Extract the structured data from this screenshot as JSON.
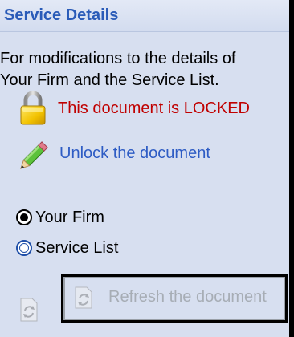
{
  "header": {
    "title": "Service Details"
  },
  "description": {
    "line1": "For modifications to the details of",
    "line2": "Your Firm and the Service List."
  },
  "lock_status": {
    "icon": "lock-icon",
    "text": "This document is LOCKED",
    "color": "#c00000"
  },
  "unlock": {
    "icon": "pencil-icon",
    "label": "Unlock the document",
    "color": "#2e5cc4"
  },
  "options": {
    "your_firm": {
      "label": "Your Firm",
      "selected": true
    },
    "service_list": {
      "label": "Service List",
      "selected": false
    }
  },
  "refresh": {
    "icon": "refresh-icon",
    "label": "Refresh the document",
    "enabled": false
  },
  "colors": {
    "panel_background": "#d7dff0",
    "header_text": "#2a5bb8"
  }
}
